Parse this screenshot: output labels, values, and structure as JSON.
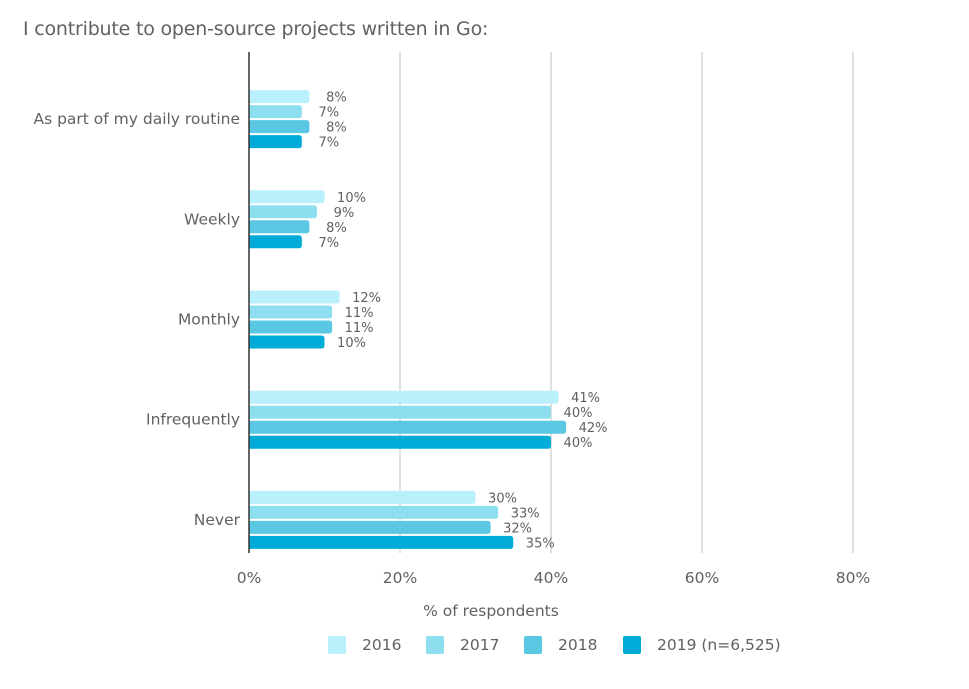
{
  "chart_data": {
    "type": "bar",
    "orientation": "horizontal",
    "title": "I contribute to open-source projects written in Go:",
    "xlabel": "% of respondents",
    "ylabel": "",
    "xlim": [
      0,
      80
    ],
    "x_ticks": [
      0,
      20,
      40,
      60,
      80
    ],
    "x_tick_labels": [
      "0%",
      "20%",
      "40%",
      "60%",
      "80%"
    ],
    "grid": true,
    "legend_position": "bottom",
    "categories": [
      "As part of my daily routine",
      "Weekly",
      "Monthly",
      "Infrequently",
      "Never"
    ],
    "series": [
      {
        "name": "2016",
        "color": "#b9f0fb",
        "values": [
          8,
          10,
          12,
          41,
          30
        ],
        "labels": [
          "8%",
          "10%",
          "12%",
          "41%",
          "30%"
        ]
      },
      {
        "name": "2017",
        "color": "#8ddff0",
        "values": [
          7,
          9,
          11,
          40,
          33
        ],
        "labels": [
          "7%",
          "9%",
          "11%",
          "40%",
          "33%"
        ]
      },
      {
        "name": "2018",
        "color": "#5ac8e2",
        "values": [
          8,
          8,
          11,
          42,
          32
        ],
        "labels": [
          "8%",
          "8%",
          "11%",
          "42%",
          "32%"
        ]
      },
      {
        "name": "2019 (n=6,525)",
        "color": "#00acd7",
        "values": [
          7,
          7,
          10,
          40,
          35
        ],
        "labels": [
          "7%",
          "7%",
          "10%",
          "40%",
          "35%"
        ]
      }
    ]
  }
}
